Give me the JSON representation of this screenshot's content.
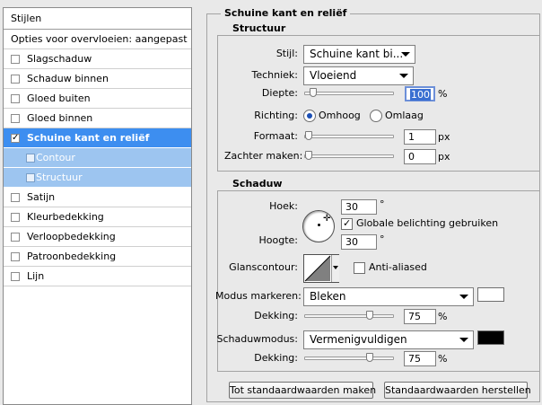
{
  "styles_panel": {
    "header": "Stijlen",
    "blend_options": "Opties voor overvloeien: aangepast",
    "items": [
      {
        "label": "Slagschaduw",
        "checked": false
      },
      {
        "label": "Schaduw binnen",
        "checked": false
      },
      {
        "label": "Gloed buiten",
        "checked": false
      },
      {
        "label": "Gloed binnen",
        "checked": false
      },
      {
        "label": "Schuine kant en reliëf",
        "checked": true
      },
      {
        "label": "Contour",
        "checked": false
      },
      {
        "label": "Structuur",
        "checked": false
      },
      {
        "label": "Satijn",
        "checked": false
      },
      {
        "label": "Kleurbedekking",
        "checked": false
      },
      {
        "label": "Verloopbedekking",
        "checked": false
      },
      {
        "label": "Patroonbedekking",
        "checked": false
      },
      {
        "label": "Lijn",
        "checked": false
      }
    ],
    "check_glyph": "✓"
  },
  "panel": {
    "title": "Schuine kant en reliëf",
    "structure": {
      "title": "Structuur",
      "style_label": "Stijl:",
      "style_value": "Schuine kant bi...",
      "technique_label": "Techniek:",
      "technique_value": "Vloeiend",
      "depth_label": "Diepte:",
      "depth_value": "100",
      "depth_unit": "%",
      "depth_level": 0.05,
      "direction_label": "Richting:",
      "direction_up": "Omhoog",
      "direction_down": "Omlaag",
      "size_label": "Formaat:",
      "size_value": "1",
      "size_unit": "px",
      "size_level": 0.0,
      "soften_label": "Zachter maken:",
      "soften_value": "0",
      "soften_unit": "px",
      "soften_level": 0.0
    },
    "shading": {
      "title": "Schaduw",
      "angle_label": "Hoek:",
      "angle_value": "30",
      "angle_unit": "°",
      "global_light_label": "Globale belichting gebruiken",
      "altitude_label": "Hoogte:",
      "altitude_value": "30",
      "altitude_unit": "°",
      "gloss_label": "Glanscontour:",
      "anti_aliased_label": "Anti-aliased",
      "highlight_label": "Modus markeren:",
      "highlight_value": "Bleken",
      "highlight_color": "#ffffff",
      "highlight_opacity_label": "Dekking:",
      "highlight_opacity_value": "75",
      "highlight_opacity_unit": "%",
      "highlight_opacity_level": 0.75,
      "shadow_label": "Schaduwmodus:",
      "shadow_value": "Vermenigvuldigen",
      "shadow_color": "#000000",
      "shadow_opacity_label": "Dekking:",
      "shadow_opacity_value": "75",
      "shadow_opacity_unit": "%",
      "shadow_opacity_level": 0.75
    },
    "buttons": {
      "make_default": "Tot standaardwaarden maken",
      "reset_default": "Standaardwaarden herstellen"
    }
  }
}
